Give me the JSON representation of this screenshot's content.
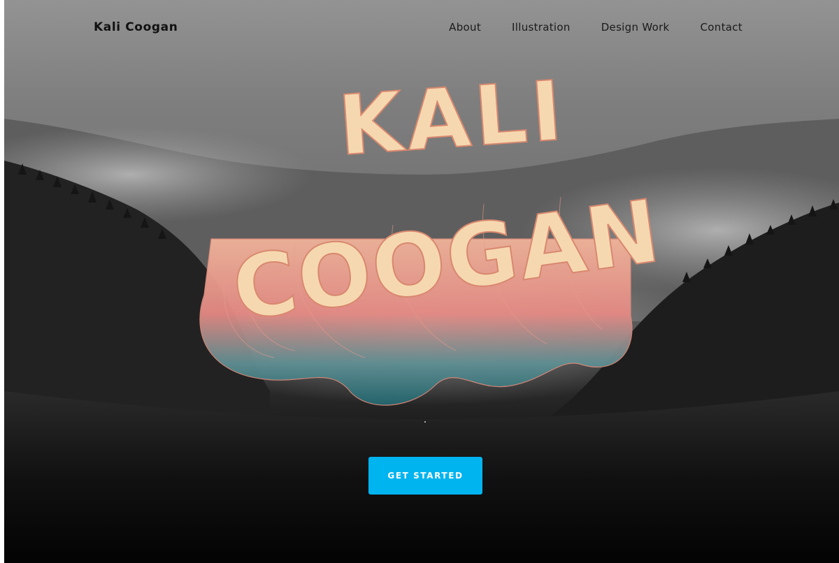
{
  "brand": {
    "name": "Kali Coogan"
  },
  "nav": {
    "items": [
      {
        "label": "About"
      },
      {
        "label": "Illustration"
      },
      {
        "label": "Design Work"
      },
      {
        "label": "Contact"
      }
    ]
  },
  "hero": {
    "logo_lettering": {
      "line1": "KALI",
      "line2": "COOGAN"
    },
    "cta_label": "GET STARTED"
  },
  "colors": {
    "accent": "#00b4f0",
    "logo_face": "#f6d8b0",
    "logo_pink": "#e9948a",
    "logo_teal": "#2b6f78",
    "nav_text": "#1a1a1a"
  },
  "icons": {
    "scroll_indicator": "dot"
  }
}
